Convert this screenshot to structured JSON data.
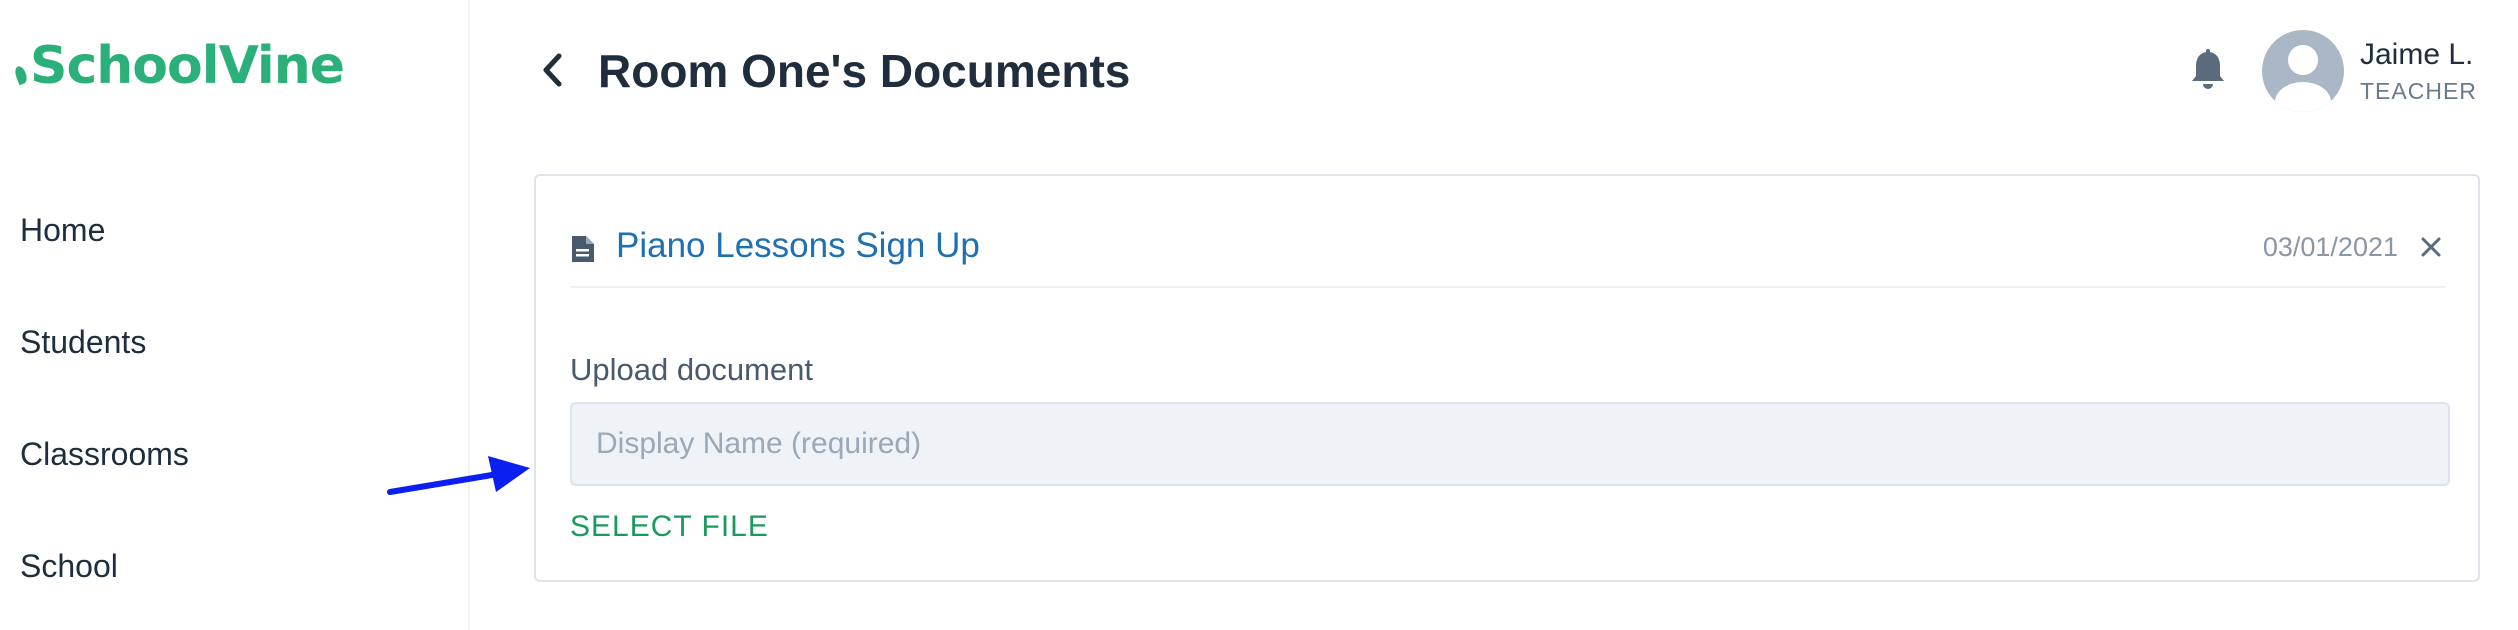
{
  "sidebar": {
    "logo": "SchoolVine",
    "items": [
      {
        "label": "Home"
      },
      {
        "label": "Students"
      },
      {
        "label": "Classrooms"
      },
      {
        "label": "School"
      }
    ]
  },
  "header": {
    "back_icon": "chevron-left-icon",
    "title": "Room One's Documents",
    "notification_icon": "bell-icon"
  },
  "user": {
    "name": "Jaime L.",
    "role": "TEACHER",
    "avatar_icon": "user-avatar-icon"
  },
  "document": {
    "icon": "document-icon",
    "title": "Piano Lessons Sign Up",
    "date": "03/01/2021",
    "close_icon": "close-icon"
  },
  "upload": {
    "label": "Upload document",
    "display_name_value": "",
    "display_name_placeholder": "Display Name (required)",
    "select_file_label": "SELECT FILE"
  },
  "colors": {
    "brand": "#2bb07a",
    "link": "#1f6fb3",
    "action": "#1a9a5c",
    "annotation": "#0a1ff0"
  }
}
